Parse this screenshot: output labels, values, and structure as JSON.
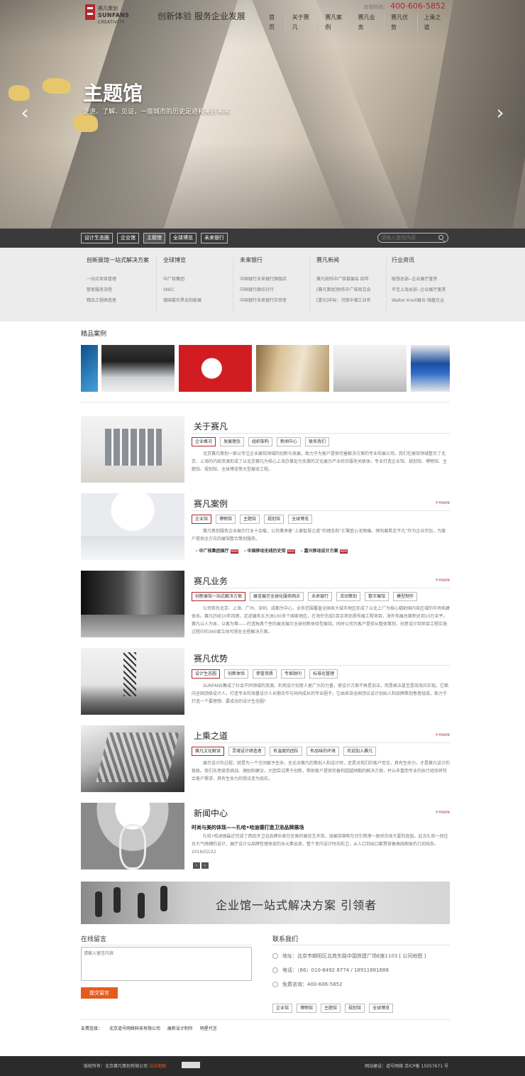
{
  "header": {
    "logo_cn": "赛凡策划",
    "logo_en": "SUNFANS",
    "logo_en2": "CREATIVITY",
    "slogan": "创新体验  服务企业发展",
    "hotline_label": "咨询热线：",
    "hotline": "400-606-5852",
    "nav": [
      "首页",
      "关于赛凡",
      "赛凡案例",
      "赛凡业务",
      "赛凡优势",
      "上乘之道"
    ]
  },
  "hero": {
    "title": "主题馆",
    "subtitle": "走进、了解、见证，一座城市的历史足迹和美好未来",
    "prev": "‹",
    "next": "›"
  },
  "tabs": {
    "items": [
      "设计生态圈",
      "企业馆",
      "主题馆",
      "全球博览",
      "未来银行"
    ],
    "active": 2
  },
  "search": {
    "placeholder": "请输入查找内容"
  },
  "mega": [
    {
      "title": "创新展馆一站式解决方案",
      "items": [
        "一站式项目管理",
        "管家服务流程",
        "精品工程缔造者"
      ]
    },
    {
      "title": "全球博览",
      "items": [
        "中广核集团",
        "SNEC",
        "德国慕尼黑太阳能展"
      ]
    },
    {
      "title": "未来银行",
      "items": [
        "中国银行未来银行旗舰店",
        "中国银行廊坊分行",
        "中国银行未来银行实验室"
      ]
    },
    {
      "title": "赛凡新闻",
      "items": [
        "赛凡助阵中广核慕展会 四年",
        "[赛凡策划]助阵中广核商交会",
        "[喜讯]中标：河南中烟工业有"
      ]
    },
    {
      "title": "行业资讯",
      "items": [
        "联想总部--企业展厅鉴赏",
        "华宝上海总部--企业展厅鉴赏",
        "Walter Knoll展台-隐匿在丛"
      ]
    }
  ],
  "cases": {
    "title": "精品案例"
  },
  "about": {
    "title": "关于赛凡",
    "tags": [
      "企业概况",
      "发展理念",
      "组织架构",
      "新闻中心",
      "联系我们"
    ],
    "text": "北京赛凡策划一家以专注企业展馆领域的创新与发展，致力于为客户提供完善解决方案的专业布展公司。我们在展馆领域整合了北京、上海的内部资源形成了以北京赛凡为核心上海办事处为支撑的文化展示产业综合服务关联体。专业打造企业馆、规划馆、博物馆、主题馆、规划馆、全球博览等大型展览工程。"
  },
  "cases_blk": {
    "title": "赛凡案例",
    "more": "+more",
    "tags": [
      "企业馆",
      "博物馆",
      "主题馆",
      "规划馆",
      "全球博览"
    ],
    "text": "赛凡策划服务企业展示行业十余载，公司秉承着“上善智慧之道”的理念和“汇聚匠心无物痛、映风载希走不凡”作为企业宗旨，为客户提供全方位的展馆整合策划服务。",
    "links": [
      "- 中广核集团展厅",
      "- 中国移动无线历史馆",
      "- 嘉兴移动设计方案"
    ],
    "new": "NEW"
  },
  "biz": {
    "title": "赛凡业务",
    "more": "+more",
    "tags": [
      "创新展馆一站式解决方案",
      "展览展示全球化服务网点",
      "未来银行",
      "活动策划",
      "数字展馆",
      "模型制作"
    ],
    "text": "公司依托北京、上海、广州、深圳、成都为中心，业务范围覆盖全国各大城市地区形成了以北上广为核心辐射国内各区域的市场拓建体系。赛凡历经10年风雨，足迹遍布五大洲100多个国家地区，在海外完成5百余项优质布展工程项目，海外布展总面积达到10万余平。赛凡以人为本，以客为尊——打造独具个性的展览展示全球创新体验型展馆，同时公司为客户提供从整体策划、创意设计到项目工程实施过程中的360度立体可视化全程解决方案。"
  },
  "adv": {
    "title": "赛凡优势",
    "tags": [
      "设计生态圈",
      "创新体验",
      "荣誉资质",
      "专家顾问",
      "标准化管理"
    ],
    "text": "SUNFANS集成了社会不同领域的资源，利用设计创意人更广大的力量，使设计方案不再是加法，而是乘法甚至是效效应实现。它面向全国顶级设计人，打造专业的海量设计人长期合作与共同成长的专业圈子。它由来自全国顶尖设计创始人和品牌策划者者组成，致力于打造一个要理想、要成功的设计生态圈！"
  },
  "way": {
    "title": "上乘之道",
    "more": "+more",
    "tags": [
      "赛凡文化解读",
      "灵魂设计缔造者",
      "有温度的团队",
      "有品味的环境",
      "欢迎加入赛凡"
    ],
    "text": "展示设计的过程，就是为一个空间赋予生命，无论对赛凡的策划人和设计师，还是对我们的客户而言，具有生命力，才是赛凡设计的极致。我们乐意接受挑战、激励和建议，大胆尝试勇于创新，帮助客户提供完备和超越预期的解决方案，并以丰富而专业的执行经验将符合客户需求、具有生命力的想法变为现实。"
  },
  "news": {
    "title": "新闻中心",
    "more": "+more",
    "headline": "时尚与美的体现——扎哈•哈迪德打造卫浴品牌展场",
    "text": "扎哈•哈迪德最近完成了西班牙卫浴品牌乐家在伦敦的展览艺术馆，该展馆堪称在切尔西港一座综合体大厦的底层。此次扎哈一改往日大气磅礴的设计，展厅设计以品牌哲理体现的水元素出发，整个室内设计时尚前卫，从入口到出口都贯穿着曲线图食的几何线条。 2016/02/22",
    "prev": "‹",
    "next": "›"
  },
  "banner": {
    "text": "企业馆一站式解决方案 引领者"
  },
  "message": {
    "title": "在线留言",
    "placeholder": "请输入留言内容",
    "submit": "提交留言"
  },
  "contact": {
    "title": "联系我们",
    "address": "地址：北京市朝阳区北苑东路中国铁建广场E座1103 [ 公司地图 ]",
    "phone": "电话：（86）010-8492 8774 / 18911881688",
    "free": "免费咨询：400-606-5852",
    "tags": [
      "企业馆",
      "博物馆",
      "主题馆",
      "规划馆",
      "全球博览"
    ]
  },
  "friends": {
    "label": "友情连接：",
    "items": [
      "北京道号网络科技有限公司",
      "展柜设计制作",
      "明星代言"
    ]
  },
  "footer": {
    "left": "版权所有：北京赛凡策划有限公司",
    "sitemap": "站点地图",
    "right": "网站建设：道号网络 京ICP备 15057671 号"
  },
  "colors": {
    "accent": "#b0272c",
    "button": "#e65b1c",
    "footer": "#2b2b2b",
    "tabbar": "#3a3a3a"
  }
}
